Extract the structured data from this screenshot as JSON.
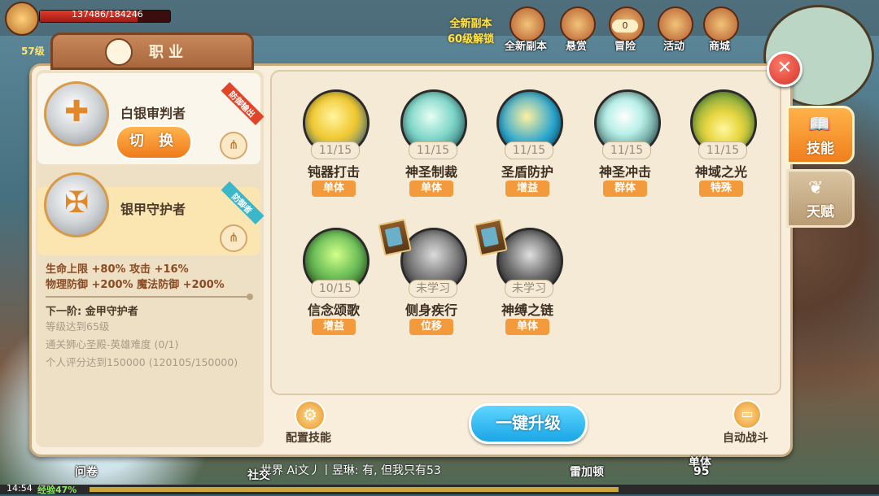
{
  "hud": {
    "hp_text": "137486/184246",
    "level_text": "57级",
    "new_dungeon_line1": "全新副本",
    "new_dungeon_line2": "60级解锁",
    "top_icons": [
      {
        "label": "全新副本",
        "icon": "new-dungeon-icon"
      },
      {
        "label": "悬赏",
        "icon": "bounty-icon"
      },
      {
        "label": "冒险",
        "icon": "adventure-icon"
      },
      {
        "label": "活动",
        "icon": "event-icon"
      },
      {
        "label": "商城",
        "icon": "shop-icon"
      }
    ],
    "adventure_badge": "0"
  },
  "panel": {
    "title": "职业",
    "close_icon": "close-icon"
  },
  "side_tabs": [
    {
      "label": "技能",
      "icon": "book-icon",
      "active": true
    },
    {
      "label": "天赋",
      "icon": "wing-icon",
      "active": false
    }
  ],
  "classes": [
    {
      "name": "白银审判者",
      "ribbon": "防御输出",
      "button": "切 换",
      "tree_icon": "tree-icon"
    },
    {
      "name": "银甲守护者",
      "ribbon": "防御者",
      "selected": true,
      "tree_icon": "tree-icon"
    }
  ],
  "stats": {
    "line1": "生命上限 +80% 攻击 +16%",
    "line2": "物理防御 +200% 魔法防御 +200%"
  },
  "next_tier": {
    "title": "下一阶: 金甲守护者",
    "requirements": [
      "等级达到65级",
      "通关狮心圣殿-英雄难度 (0/1)",
      "个人评分达到150000 (120105/150000)"
    ]
  },
  "skills": [
    {
      "name": "钝器打击",
      "level": "11/15",
      "tag": "单体",
      "icon": "hammer-strike-icon",
      "color": "#f0c830"
    },
    {
      "name": "神圣制裁",
      "level": "11/15",
      "tag": "单体",
      "icon": "holy-sanction-icon",
      "color": "#7fd6c9"
    },
    {
      "name": "圣盾防护",
      "level": "11/15",
      "tag": "增益",
      "icon": "holy-shield-icon",
      "color": "#2aa6cf"
    },
    {
      "name": "神圣冲击",
      "level": "11/15",
      "tag": "群体",
      "icon": "holy-impact-icon",
      "color": "#1a4a4a"
    },
    {
      "name": "神域之光",
      "level": "11/15",
      "tag": "特殊",
      "icon": "divine-light-icon",
      "color": "#3a8a3a"
    },
    {
      "name": "信念颂歌",
      "level": "10/15",
      "tag": "增益",
      "icon": "faith-hymn-icon",
      "color": "#6fc15a"
    },
    {
      "name": "侧身疾行",
      "level": "未学习",
      "tag": "位移",
      "icon": "sidestep-icon",
      "color": "#7a7a7a",
      "locked": true
    },
    {
      "name": "神缚之链",
      "level": "未学习",
      "tag": "单体",
      "icon": "divine-chain-icon",
      "color": "#6a6a6a",
      "locked": true
    }
  ],
  "bottom": {
    "config_label": "配置技能",
    "upgrade_label": "一键升级",
    "auto_label": "自动战斗",
    "config_icon": "gear-icon",
    "auto_icon": "monitor-icon"
  },
  "chat": {
    "text": "世界 Ai文丿丨昱琳: 有, 但我只有53"
  },
  "bottom_hud": {
    "time": "14:54",
    "xp": "经验47%",
    "labels": [
      "问卷",
      "社交",
      "雷加顿",
      "单体"
    ],
    "count": "95"
  }
}
